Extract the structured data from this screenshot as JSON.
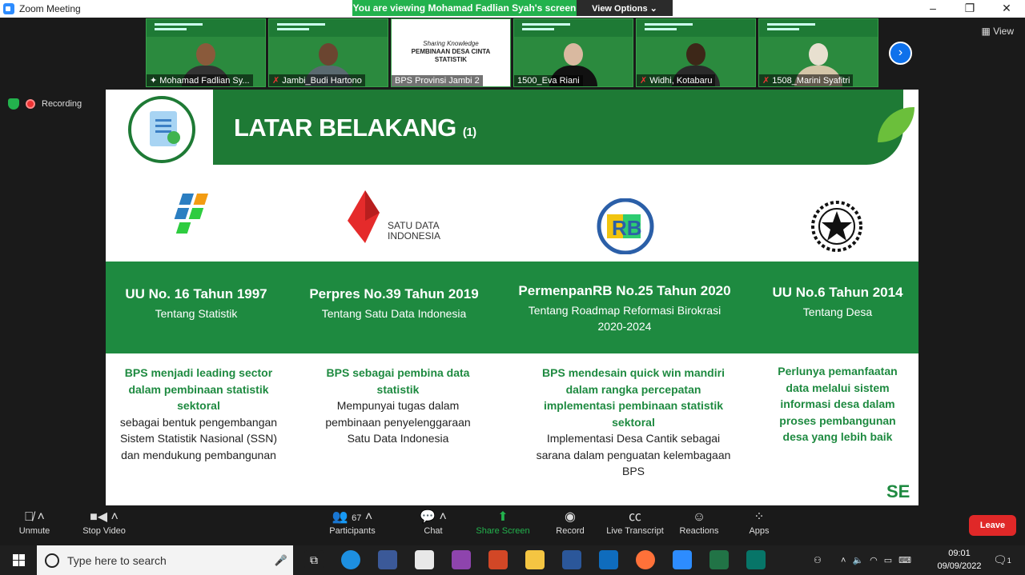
{
  "window": {
    "title": "Zoom Meeting",
    "controls": [
      "–",
      "❐",
      "✕"
    ]
  },
  "viewing_banner": {
    "message": "You are viewing Mohamad Fadlian Syah's screen",
    "options_label": "View Options ⌄"
  },
  "view_button": {
    "label": "View",
    "icon": "grid-icon"
  },
  "recording": {
    "label": "Recording"
  },
  "participants_strip": [
    {
      "name": "Mohamad Fadlian Sy...",
      "muted": false
    },
    {
      "name": "Jambi_Budi Hartono",
      "muted": true
    },
    {
      "name": "BPS Provinsi Jambi 2",
      "muted": false,
      "shared_slide": {
        "line1": "Sharing Knowledge",
        "line2": "PEMBINAAN DESA CINTA",
        "line3": "STATISTIK"
      }
    },
    {
      "name": "1500_Eva Riani",
      "muted": false
    },
    {
      "name": "Widhi, Kotabaru",
      "muted": true
    },
    {
      "name": "1508_Marini Syafitri",
      "muted": true
    }
  ],
  "slide": {
    "title": "LATAR BELAKANG",
    "title_suffix": "(1)",
    "logos": {
      "sdi_line1": "SATU DATA",
      "sdi_line2": "INDONESIA",
      "rb_text": "RB"
    },
    "columns": [
      {
        "law": "UU No. 16 Tahun 1997",
        "about": "Tentang Statistik",
        "desc_bold": "BPS menjadi leading sector dalam pembinaan statistik sektoral",
        "desc_plain": "sebagai bentuk pengembangan Sistem Statistik Nasional (SSN) dan mendukung pembangunan"
      },
      {
        "law": "Perpres No.39 Tahun 2019",
        "about": "Tentang Satu Data Indonesia",
        "desc_bold": "BPS sebagai pembina data statistik",
        "desc_plain": "Mempunyai tugas dalam pembinaan penyelenggaraan Satu Data Indonesia"
      },
      {
        "law": "PermenpanRB No.25 Tahun 2020",
        "about": "Tentang Roadmap Reformasi Birokrasi 2020-2024",
        "desc_bold": "BPS mendesain quick win mandiri dalam rangka percepatan implementasi pembinaan statistik sektoral",
        "desc_plain": "Implementasi Desa Cantik sebagai sarana dalam penguatan kelembagaan BPS"
      },
      {
        "law": "UU No.6 Tahun 2014",
        "about": "Tentang Desa",
        "desc_bold": "Perlunya pemanfaatan data melalui sistem informasi desa dalam proses pembangunan desa yang lebih baik",
        "desc_plain": ""
      }
    ],
    "corner_mark": "SE"
  },
  "toolbar": {
    "unmute": "Unmute",
    "stop_video": "Stop Video",
    "participants": "Participants",
    "participants_count": "67",
    "chat": "Chat",
    "share_screen": "Share Screen",
    "record": "Record",
    "live_transcript": "Live Transcript",
    "reactions": "Reactions",
    "apps": "Apps",
    "leave": "Leave"
  },
  "taskbar": {
    "search_placeholder": "Type here to search",
    "time": "09:01",
    "date": "09/09/2022",
    "notification_count": "1"
  },
  "colors": {
    "green": "#1e8a40",
    "dark_green": "#1e7a35",
    "leave_red": "#e02828",
    "zoom_blue": "#0e71eb"
  }
}
